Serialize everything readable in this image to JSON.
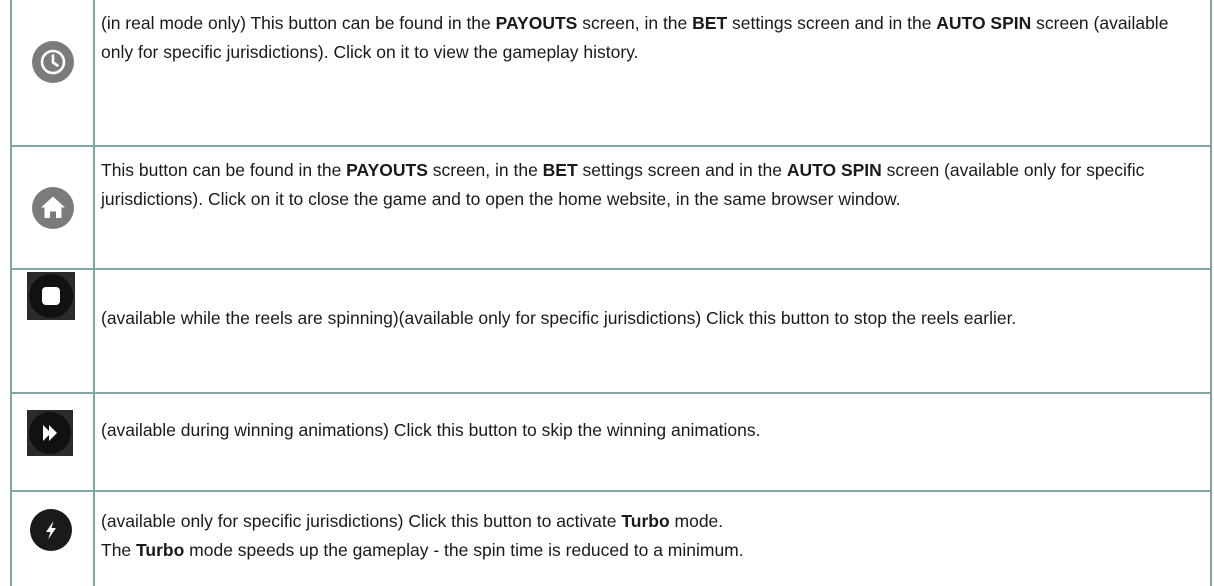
{
  "rows": [
    {
      "icon": "history-clock-icon",
      "segments": [
        {
          "t": "(in real mode only) This button can be found in the ",
          "b": false
        },
        {
          "t": "PAYOUTS",
          "b": true
        },
        {
          "t": " screen, in the ",
          "b": false
        },
        {
          "t": "BET",
          "b": true
        },
        {
          "t": " settings screen and in the ",
          "b": false
        },
        {
          "t": "AUTO SPIN",
          "b": true
        },
        {
          "t": " screen (available only for specific jurisdictions). Click on it to view the gameplay history.",
          "b": false
        }
      ]
    },
    {
      "icon": "home-icon",
      "segments": [
        {
          "t": "This button can be found in the ",
          "b": false
        },
        {
          "t": "PAYOUTS",
          "b": true
        },
        {
          "t": " screen, in the ",
          "b": false
        },
        {
          "t": "BET",
          "b": true
        },
        {
          "t": " settings screen and in the ",
          "b": false
        },
        {
          "t": "AUTO SPIN",
          "b": true
        },
        {
          "t": " screen (available only for specific jurisdictions). Click on it to close the game and to open the home website, in the same browser window.",
          "b": false
        }
      ]
    },
    {
      "icon": "stop-icon",
      "segments": [
        {
          "t": "(available while the reels are spinning)(available only for specific jurisdictions) Click this button to stop the reels earlier.",
          "b": false
        }
      ]
    },
    {
      "icon": "skip-forward-icon",
      "segments": [
        {
          "t": "(available during winning animations) Click this button to skip the winning animations.",
          "b": false
        }
      ]
    },
    {
      "icon": "turbo-lightning-icon",
      "lines": [
        [
          {
            "t": "(available only for specific jurisdictions) Click this button to activate ",
            "b": false
          },
          {
            "t": "Turbo",
            "b": true
          },
          {
            "t": " mode.",
            "b": false
          }
        ],
        [
          {
            "t": "The ",
            "b": false
          },
          {
            "t": "Turbo",
            "b": true
          },
          {
            "t": " mode speeds up the gameplay - the spin time is reduced to a minimum.",
            "b": false
          }
        ]
      ]
    }
  ]
}
